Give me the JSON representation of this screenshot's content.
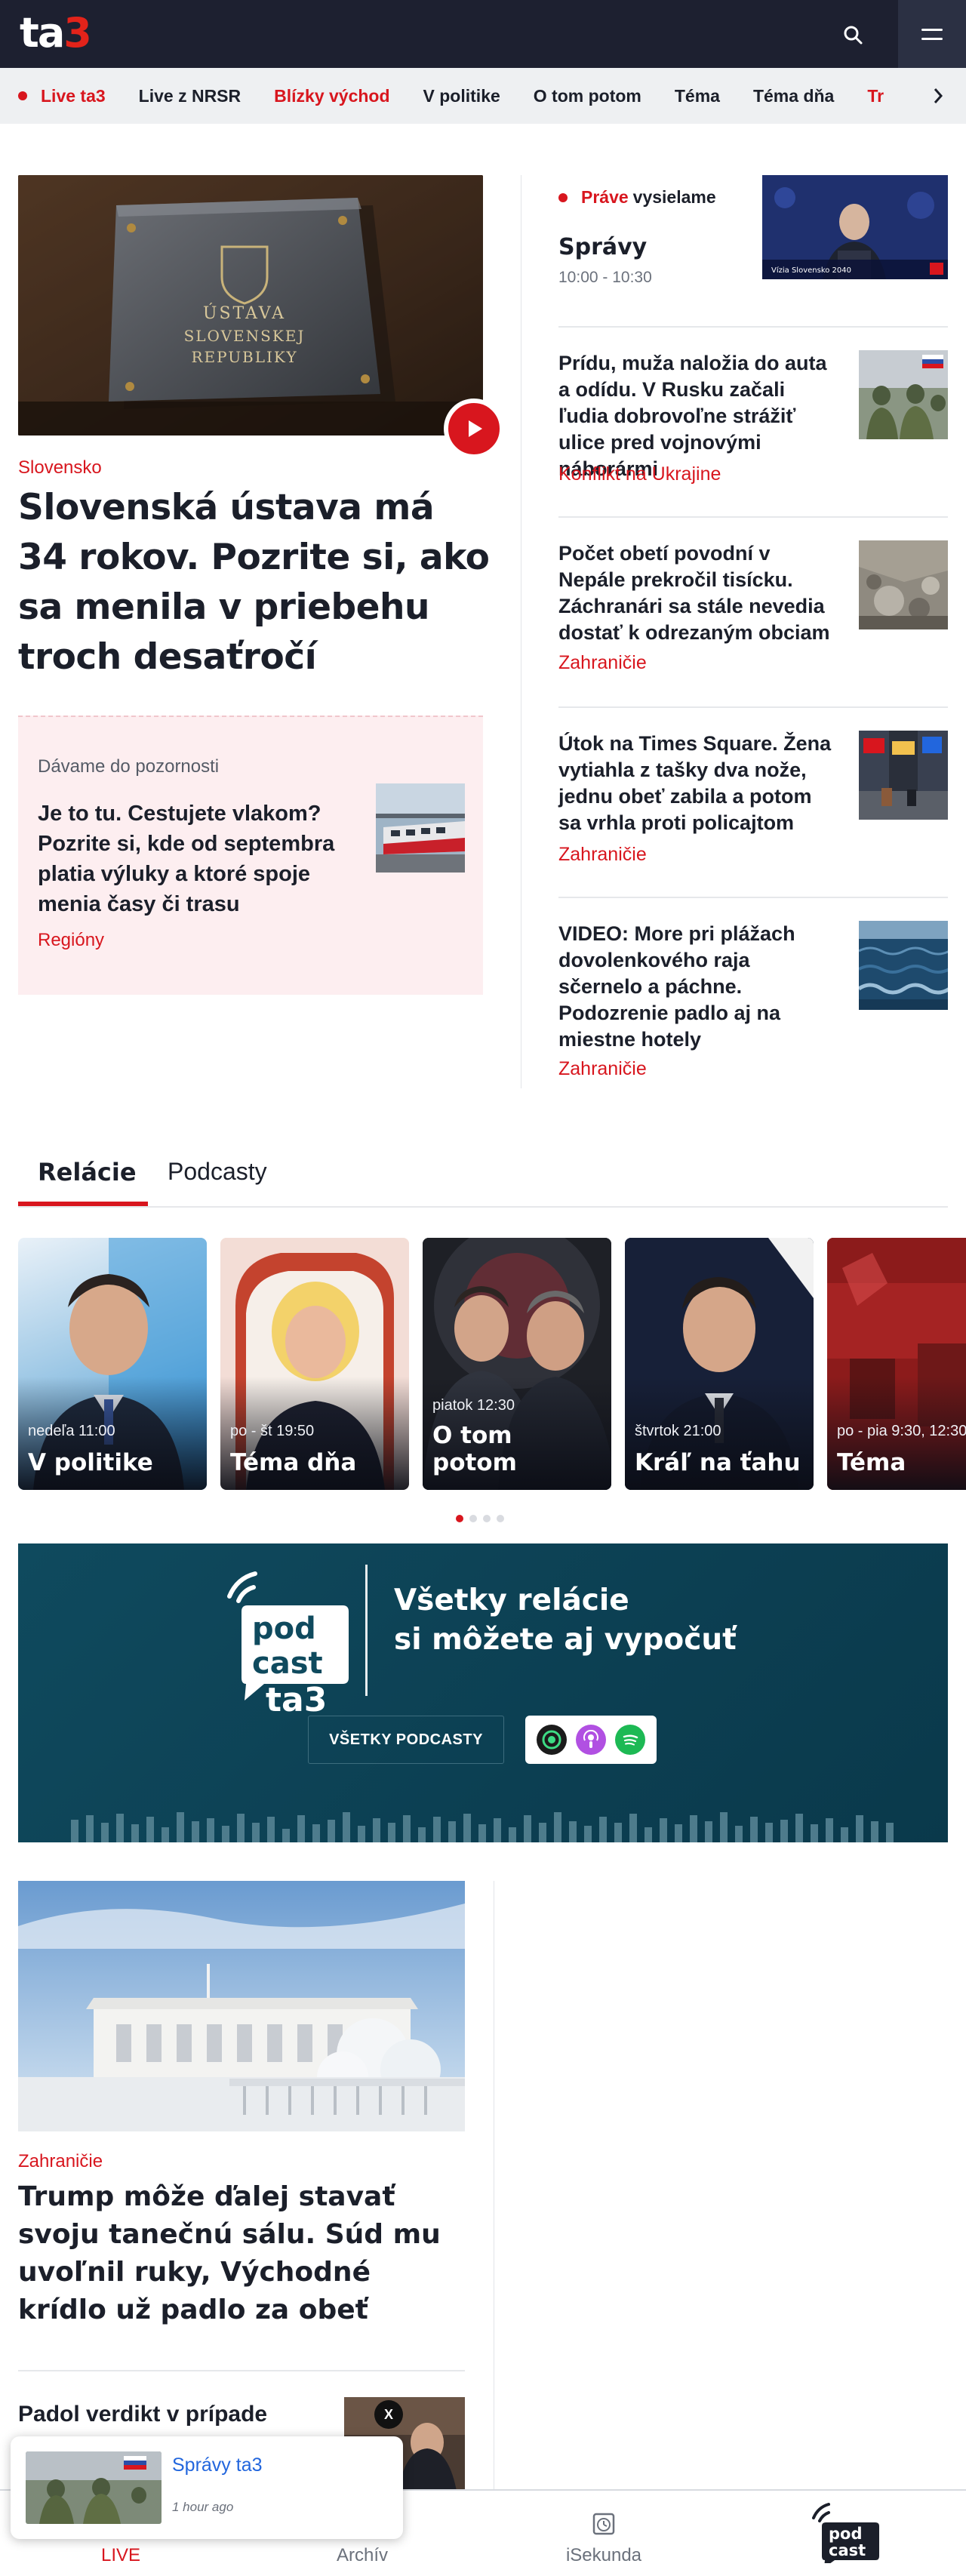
{
  "header": {
    "logo_main": "ta",
    "logo_accent": "3"
  },
  "nav": {
    "items": [
      {
        "label": "Live ta3",
        "style": "live"
      },
      {
        "label": "Live z NRSR",
        "style": "normal"
      },
      {
        "label": "Blízky východ",
        "style": "red"
      },
      {
        "label": "V politike",
        "style": "normal"
      },
      {
        "label": "O tom potom",
        "style": "normal"
      },
      {
        "label": "Téma",
        "style": "normal"
      },
      {
        "label": "Téma dňa",
        "style": "normal"
      },
      {
        "label": "Tr",
        "style": "red"
      }
    ]
  },
  "hero": {
    "category": "Slovensko",
    "title": "Slovenská ústava má 34 rokov. Pozrite si, ako sa menila v priebehu troch desaťročí",
    "image_text": "ÚSTAVA SLOVENSKEJ REPUBLIKY"
  },
  "attention": {
    "label": "Dávame do pozornosti",
    "title": "Je to tu. Cestujete vlakom? Pozrite si, kde od septembra platia výluky a ktoré spoje menia časy či trasu",
    "category": "Regióny"
  },
  "now_live": {
    "prefix": "Práve",
    "suffix": "vysielame",
    "show": "Správy",
    "time": "10:00 - 10:30",
    "thumb_caption": "Vízia Slovensko 2040"
  },
  "side_articles": [
    {
      "title": "Prídu, muža naložia do auta a odídu. V Rusku začali ľudia dobrovoľne strážiť ulice pred vojnovými náborármi",
      "category": "Konflikt na Ukrajine"
    },
    {
      "title": "Počet obetí povodní v Nepále prekročil tisícku. Záchranári sa stále nevedia dostať k odrezaným obciam",
      "category": "Zahraničie"
    },
    {
      "title": "Útok na Times Square. Žena vytiahla z tašky dva nože, jednu obeť zabila a potom sa vrhla proti policajtom",
      "category": "Zahraničie"
    },
    {
      "title": "VIDEO: More pri plážach dovolenkového raja sčernelo a páchne. Podozrenie padlo aj na miestne hotely",
      "category": "Zahraničie"
    }
  ],
  "tabs": {
    "active": "Relácie",
    "other": "Podcasty"
  },
  "shows": [
    {
      "schedule": "nedeľa 11:00",
      "name": "V politike"
    },
    {
      "schedule": "po - št 19:50",
      "name": "Téma dňa"
    },
    {
      "schedule": "piatok 12:30",
      "name": "O tom potom"
    },
    {
      "schedule": "štvrtok 21:00",
      "name": "Kráľ na ťahu"
    },
    {
      "schedule": "po - pia 9:30, 12:30",
      "name": "Téma"
    }
  ],
  "podcast_banner": {
    "logo_line1": "pod",
    "logo_line2": "cast",
    "logo_line3": "ta3",
    "heading_line1": "Všetky relácie",
    "heading_line2": "si môžete aj vypočuť",
    "button": "VŠETKY PODCASTY",
    "platform_icons": [
      "spotify-like-podcast-icon",
      "apple-podcasts-icon",
      "spotify-icon"
    ]
  },
  "article_main": {
    "category": "Zahraničie",
    "title": "Trump môže ďalej stavať svoju tanečnú sálu. Súd mu uvoľnil ruky, Východné krídlo už padlo za obeť"
  },
  "article_second": {
    "title": "Padol verdikt v prípade"
  },
  "mini_player": {
    "title": "Správy ta3",
    "time": "1 hour ago",
    "close": "X"
  },
  "bottom_nav": {
    "items": [
      {
        "label": "LIVE",
        "icon": "live-play-icon",
        "active": true
      },
      {
        "label": "Archív",
        "icon": "archive-icon",
        "active": false
      },
      {
        "label": "iSekunda",
        "icon": "clock-icon",
        "active": false
      },
      {
        "label": "",
        "icon": "podcast-logo-icon",
        "active": false
      }
    ],
    "podcast_logo_l1": "pod",
    "podcast_logo_l2": "cast"
  },
  "colors": {
    "accent": "#d8161e",
    "header_bg": "#1d2030",
    "banner_bg": "#0f4a5e",
    "link_blue": "#2266dd"
  }
}
